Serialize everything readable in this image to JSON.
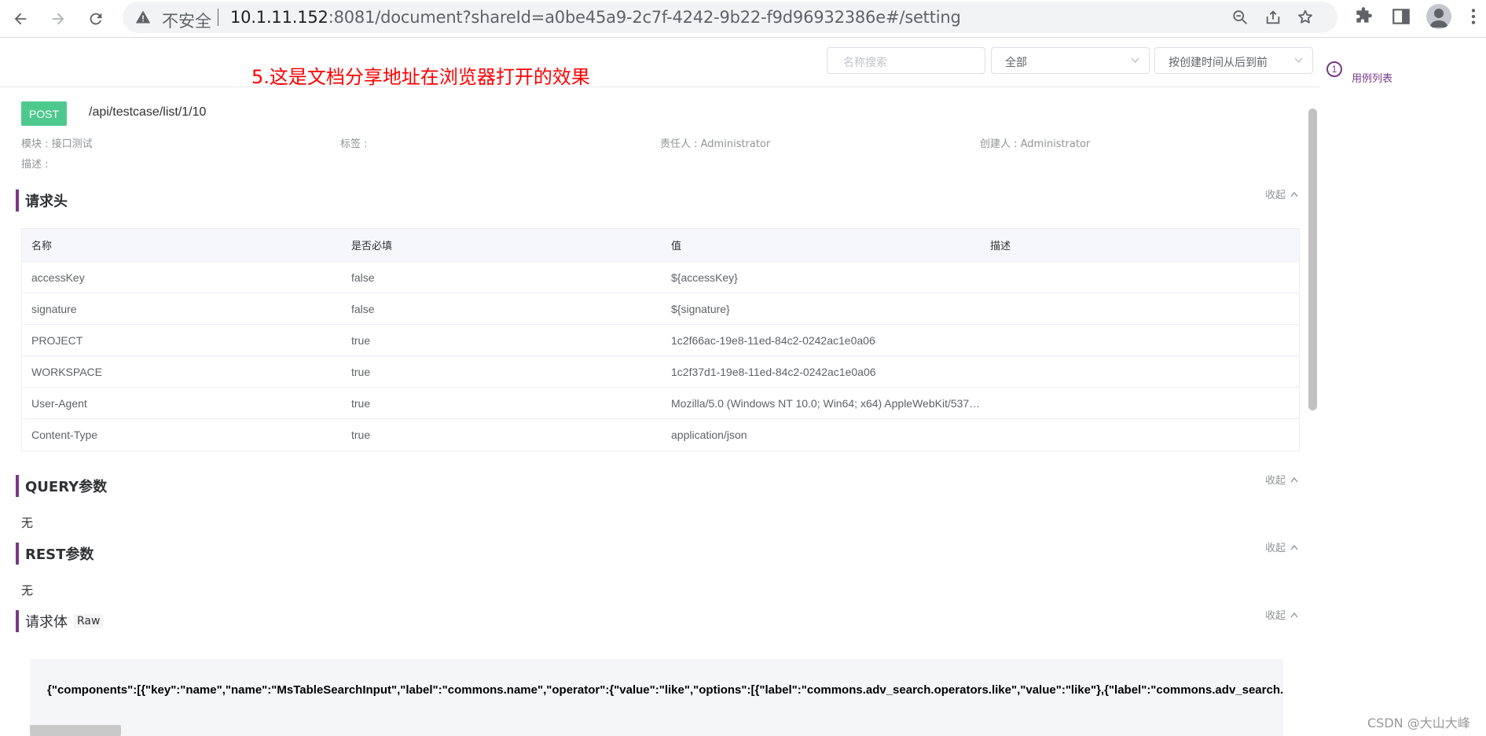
{
  "browser": {
    "security_label": "不安全",
    "url_host": "10.1.11.152",
    "url_rest": ":8081/document?shareId=a0be45a9-2c7f-4242-9b22-f9d96932386e#/setting"
  },
  "annotation": "5.这是文档分享地址在浏览器打开的效果",
  "toolbar": {
    "search_placeholder": "名称搜索",
    "filter_value": "全部",
    "sort_value": "按创建时间从后到前"
  },
  "side": {
    "step_number": "1",
    "case_list_label": "用例列表"
  },
  "api": {
    "method": "POST",
    "path": "/api/testcase/list/1/10",
    "module": "模块 : 接口测试",
    "tags": "标签 :",
    "owner": "责任人 : Administrator",
    "creator": "创建人 : Administrator",
    "description": "描述 :"
  },
  "sections": {
    "headers_title": "请求头",
    "query_title": "QUERY参数",
    "rest_title": "REST参数",
    "body_title": "请求体",
    "body_type": "Raw",
    "collapse_label": "收起",
    "none_text": "无"
  },
  "headers_table": {
    "columns": [
      "名称",
      "是否必填",
      "值",
      "描述"
    ],
    "rows": [
      [
        "accessKey",
        "false",
        "${accessKey}",
        ""
      ],
      [
        "signature",
        "false",
        "${signature}",
        ""
      ],
      [
        "PROJECT",
        "true",
        "1c2f66ac-19e8-11ed-84c2-0242ac1e0a06",
        ""
      ],
      [
        "WORKSPACE",
        "true",
        "1c2f37d1-19e8-11ed-84c2-0242ac1e0a06",
        ""
      ],
      [
        "User-Agent",
        "true",
        "Mozilla/5.0 (Windows NT 10.0; Win64; x64) AppleWebKit/537…",
        ""
      ],
      [
        "Content-Type",
        "true",
        "application/json",
        ""
      ]
    ]
  },
  "request_body": "{\"components\":[{\"key\":\"name\",\"name\":\"MsTableSearchInput\",\"label\":\"commons.name\",\"operator\":{\"value\":\"like\",\"options\":[{\"label\":\"commons.adv_search.operators.like\",\"value\":\"like\"},{\"label\":\"commons.adv_search.operators.not_like\"",
  "watermark": "CSDN @大山大峰",
  "colors": {
    "accent": "#783887",
    "method_post": "#4ec98e",
    "annotation": "#ff0000"
  }
}
